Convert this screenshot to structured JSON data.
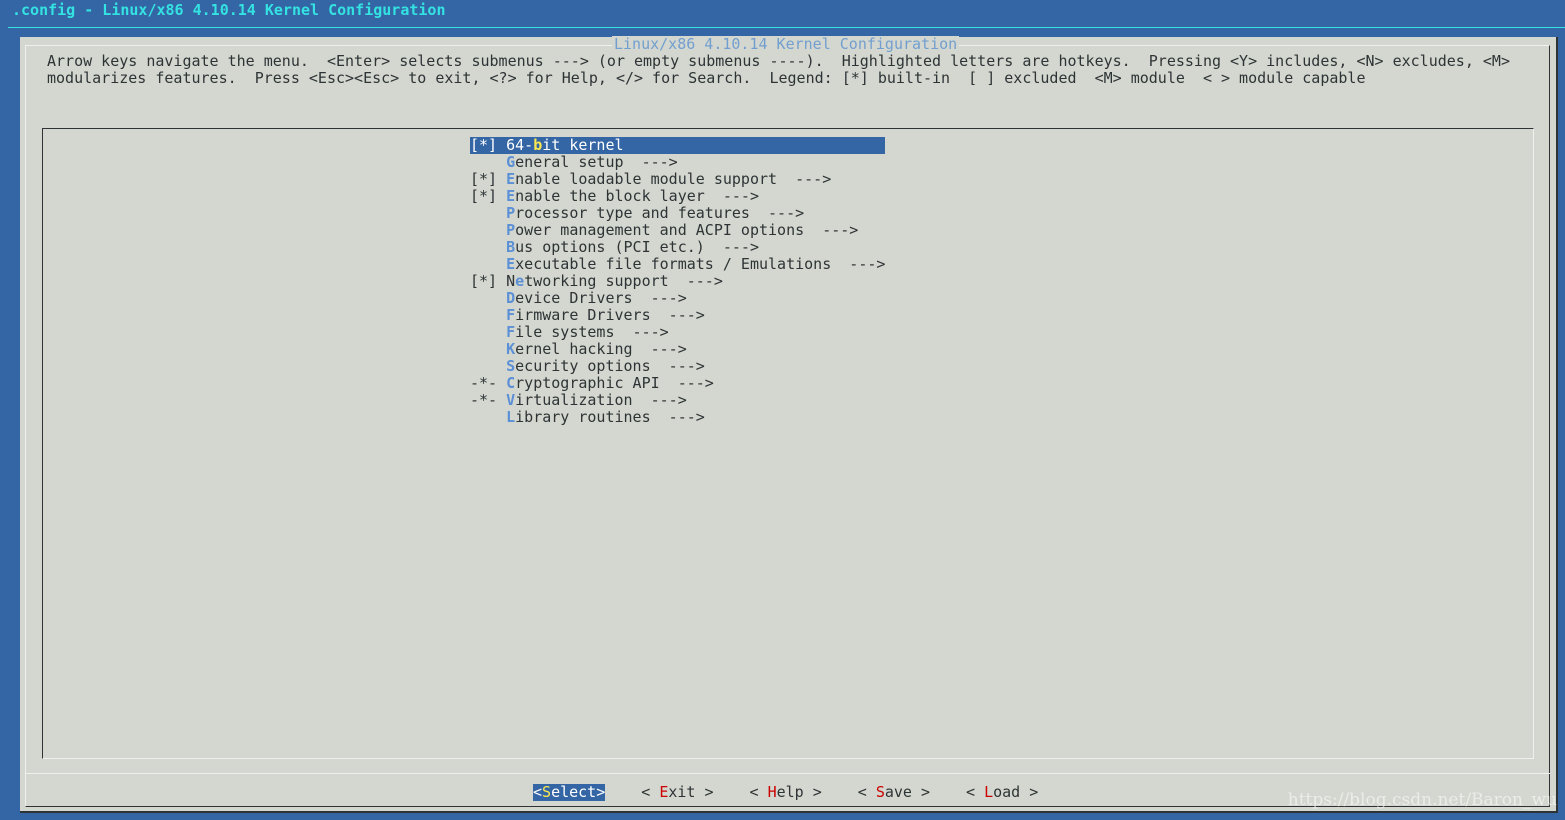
{
  "window_title": ".config - Linux/x86 4.10.14 Kernel Configuration",
  "dialog_title": "Linux/x86 4.10.14 Kernel Configuration",
  "help_lines": [
    "Arrow keys navigate the menu.  <Enter> selects submenus ---> (or empty submenus ----).  Highlighted letters are hotkeys.  Pressing <Y> includes, <N> excludes, <M>",
    "modularizes features.  Press <Esc><Esc> to exit, <?> for Help, </> for Search.  Legend: [*] built-in  [ ] excluded  <M> module  < > module capable"
  ],
  "menu_items": [
    {
      "prefix": "[*] ",
      "before": "64-",
      "hot": "b",
      "after": "it kernel",
      "selected": true
    },
    {
      "prefix": "    ",
      "before": "",
      "hot": "G",
      "after": "eneral setup  --->"
    },
    {
      "prefix": "[*] ",
      "before": "",
      "hot": "E",
      "after": "nable loadable module support  --->"
    },
    {
      "prefix": "[*] ",
      "before": "",
      "hot": "E",
      "after": "nable the block layer  --->"
    },
    {
      "prefix": "    ",
      "before": "",
      "hot": "P",
      "after": "rocessor type and features  --->"
    },
    {
      "prefix": "    ",
      "before": "",
      "hot": "P",
      "after": "ower management and ACPI options  --->"
    },
    {
      "prefix": "    ",
      "before": "",
      "hot": "B",
      "after": "us options (PCI etc.)  --->"
    },
    {
      "prefix": "    ",
      "before": "",
      "hot": "E",
      "after": "xecutable file formats / Emulations  --->"
    },
    {
      "prefix": "[*] ",
      "before": "N",
      "hot": "e",
      "after": "tworking support  --->"
    },
    {
      "prefix": "    ",
      "before": "",
      "hot": "D",
      "after": "evice Drivers  --->"
    },
    {
      "prefix": "    ",
      "before": "",
      "hot": "F",
      "after": "irmware Drivers  --->"
    },
    {
      "prefix": "    ",
      "before": "",
      "hot": "F",
      "after": "ile systems  --->"
    },
    {
      "prefix": "    ",
      "before": "",
      "hot": "K",
      "after": "ernel hacking  --->"
    },
    {
      "prefix": "    ",
      "before": "",
      "hot": "S",
      "after": "ecurity options  --->"
    },
    {
      "prefix": "-*- ",
      "before": "",
      "hot": "C",
      "after": "ryptographic API  --->"
    },
    {
      "prefix": "-*- ",
      "before": "",
      "hot": "V",
      "after": "irtualization  --->"
    },
    {
      "prefix": "    ",
      "before": "",
      "hot": "L",
      "after": "ibrary routines  --->"
    }
  ],
  "buttons": [
    {
      "before": "<",
      "hot": "S",
      "after": "elect>",
      "active": true
    },
    {
      "before": "< ",
      "hot": "E",
      "after": "xit >"
    },
    {
      "before": "< ",
      "hot": "H",
      "after": "elp >"
    },
    {
      "before": "< ",
      "hot": "S",
      "after": "ave >"
    },
    {
      "before": "< ",
      "hot": "L",
      "after": "oad >"
    }
  ],
  "watermark": "https://blog.csdn.net/Baron_wu",
  "colors": {
    "background": "#3465a4",
    "dialog": "#d3d7cf",
    "hotkey": "#5b8fd6",
    "button_hotkey": "#cc0000",
    "selected_hotkey": "#fce94f"
  }
}
